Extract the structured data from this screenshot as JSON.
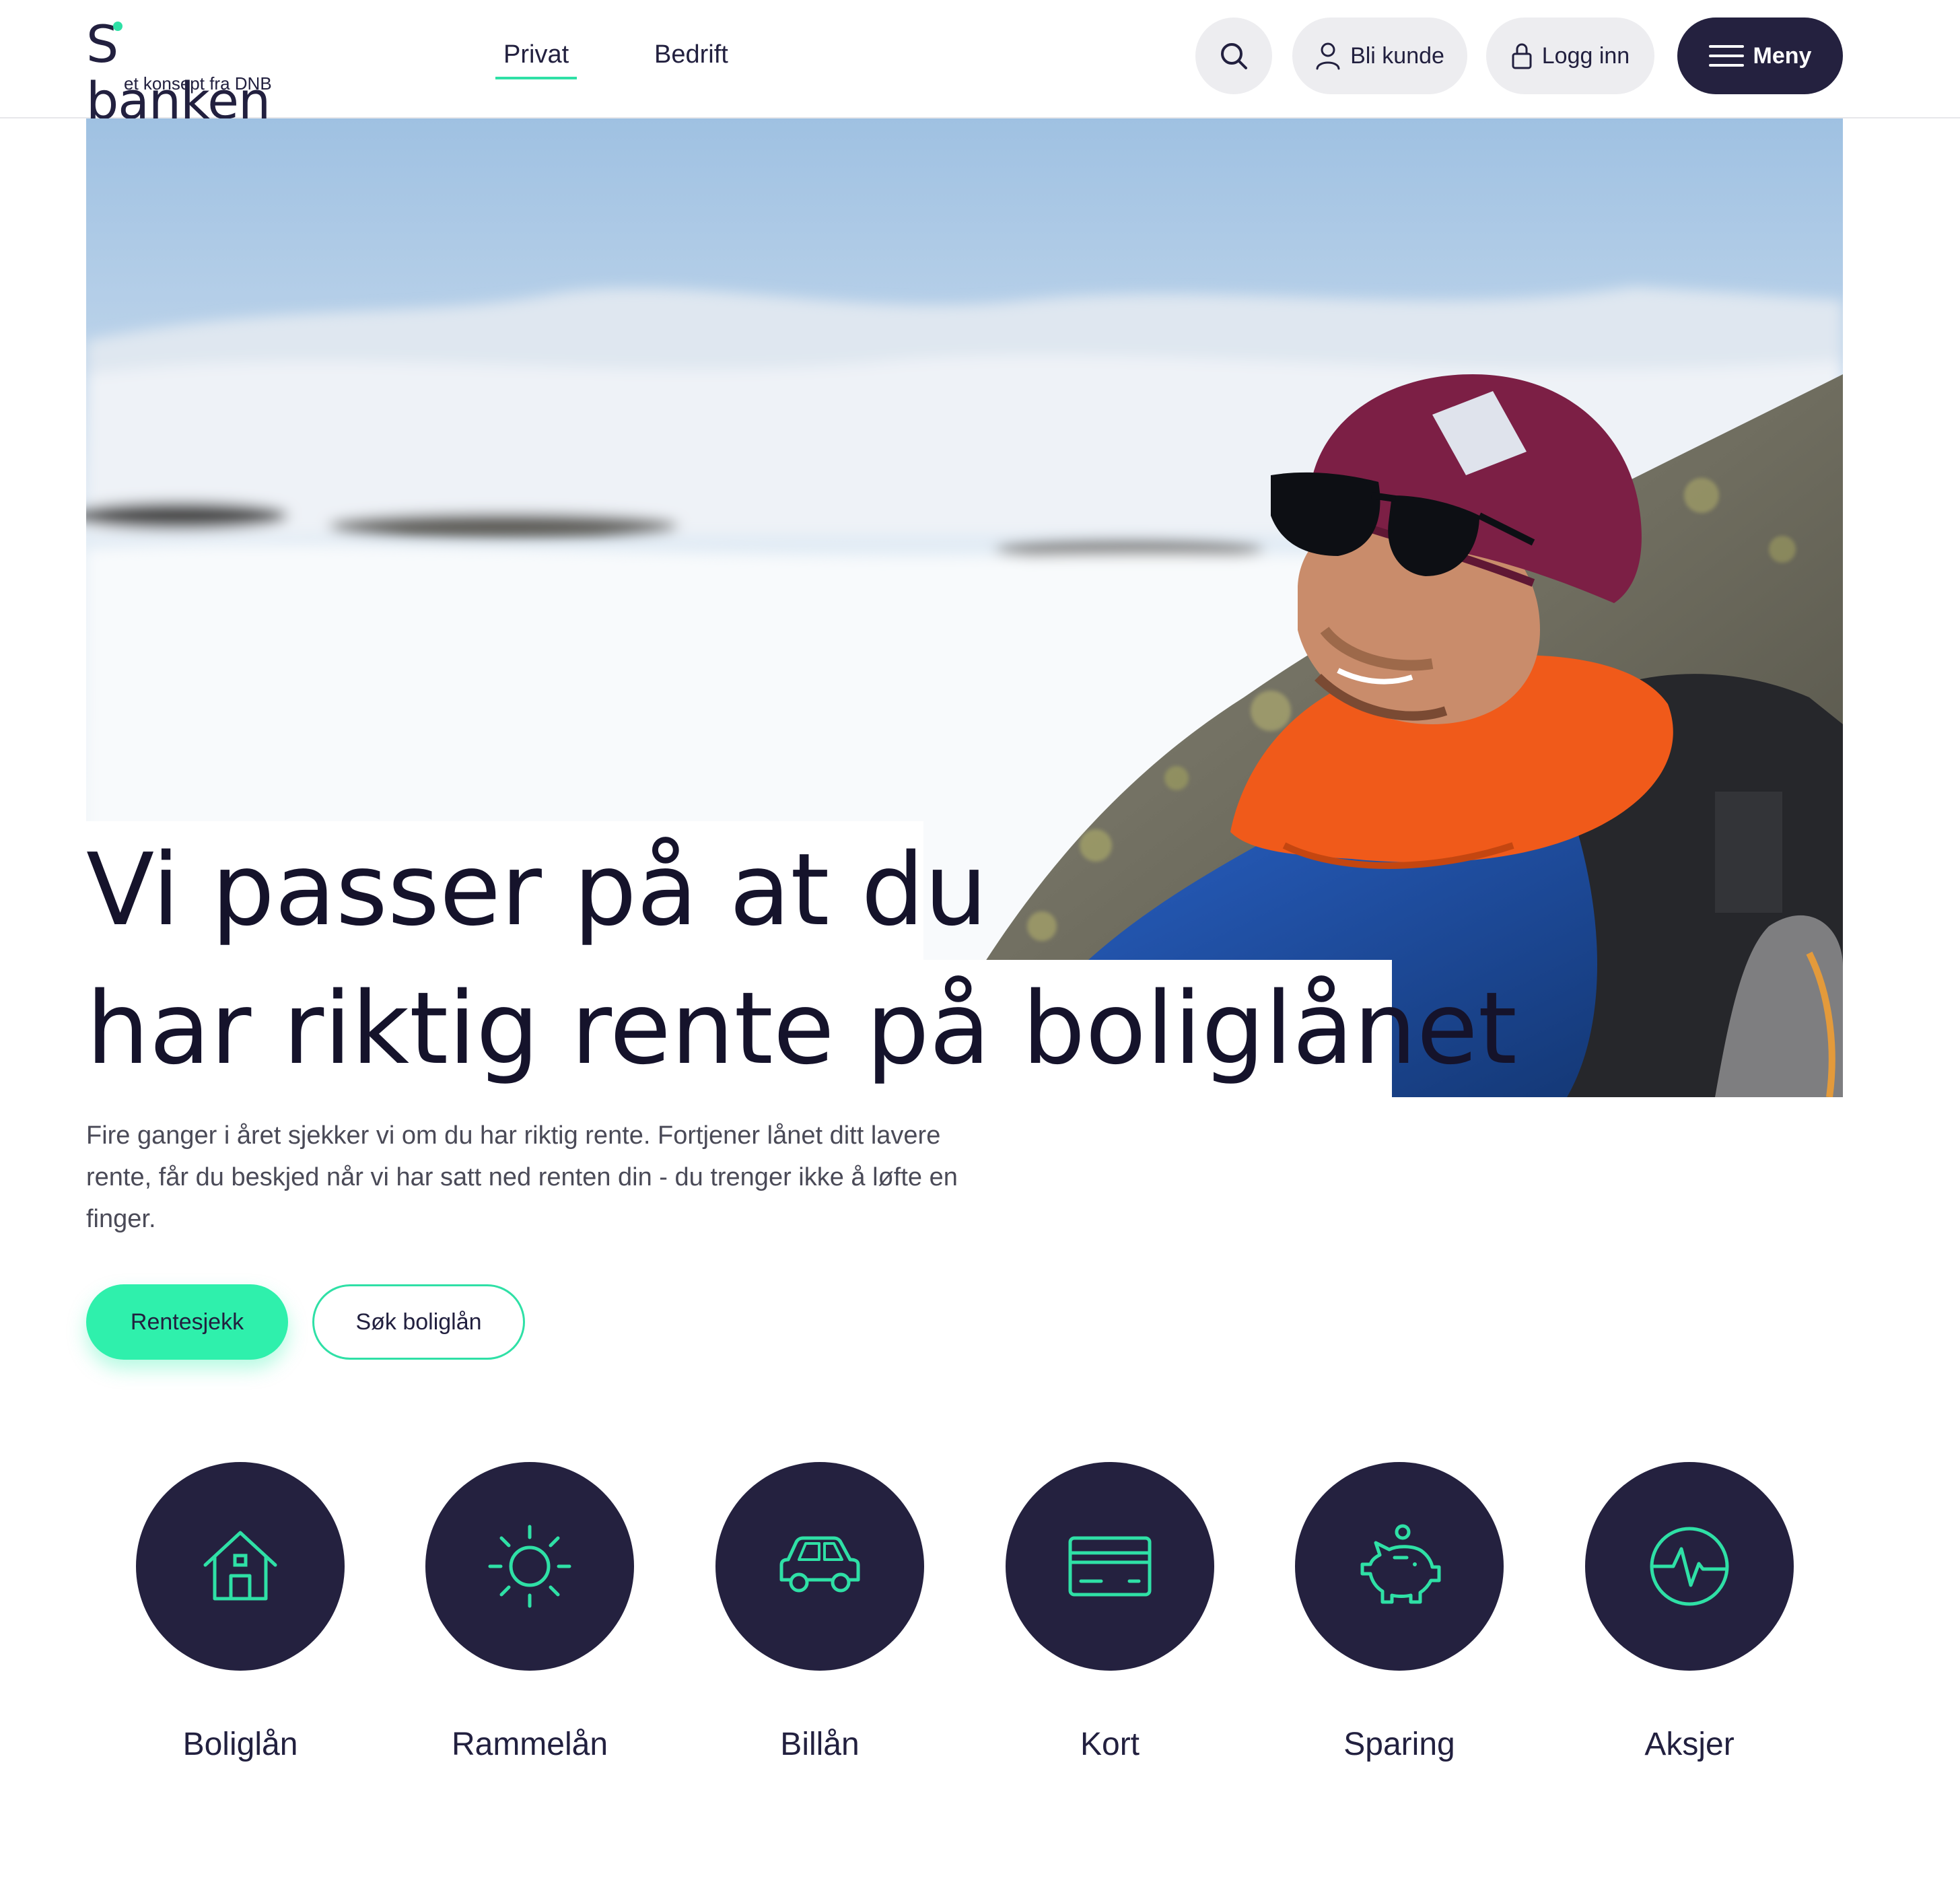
{
  "header": {
    "logo": {
      "name": "S banken",
      "tagline": "et konsept fra DNB"
    },
    "tabs": [
      {
        "label": "Privat",
        "active": true
      },
      {
        "label": "Bedrift",
        "active": false
      }
    ],
    "search_icon": "search-icon",
    "become_customer": "Bli kunde",
    "login": "Logg inn",
    "menu": "Meny"
  },
  "hero": {
    "headline_line1": "Vi passer på at du",
    "headline_line2": "har riktig rente på boliglånet",
    "lead": "Fire ganger i året sjekker vi om du har riktig rente. Fortjener lånet ditt lavere rente, får du beskjed når vi har satt ned renten din - du trenger ikke å løfte en finger.",
    "primary_button": "Rentesjekk",
    "secondary_button": "Søk boliglån"
  },
  "products": [
    {
      "label": "Boliglån",
      "icon": "house-icon"
    },
    {
      "label": "Rammelån",
      "icon": "sun-icon"
    },
    {
      "label": "Billån",
      "icon": "car-icon"
    },
    {
      "label": "Kort",
      "icon": "card-icon"
    },
    {
      "label": "Sparing",
      "icon": "piggy-bank-icon"
    },
    {
      "label": "Aksjer",
      "icon": "pulse-icon"
    }
  ],
  "colors": {
    "brand_dark": "#24213f",
    "accent_green": "#2ff0ac",
    "icon_green": "#2fe0a6"
  }
}
